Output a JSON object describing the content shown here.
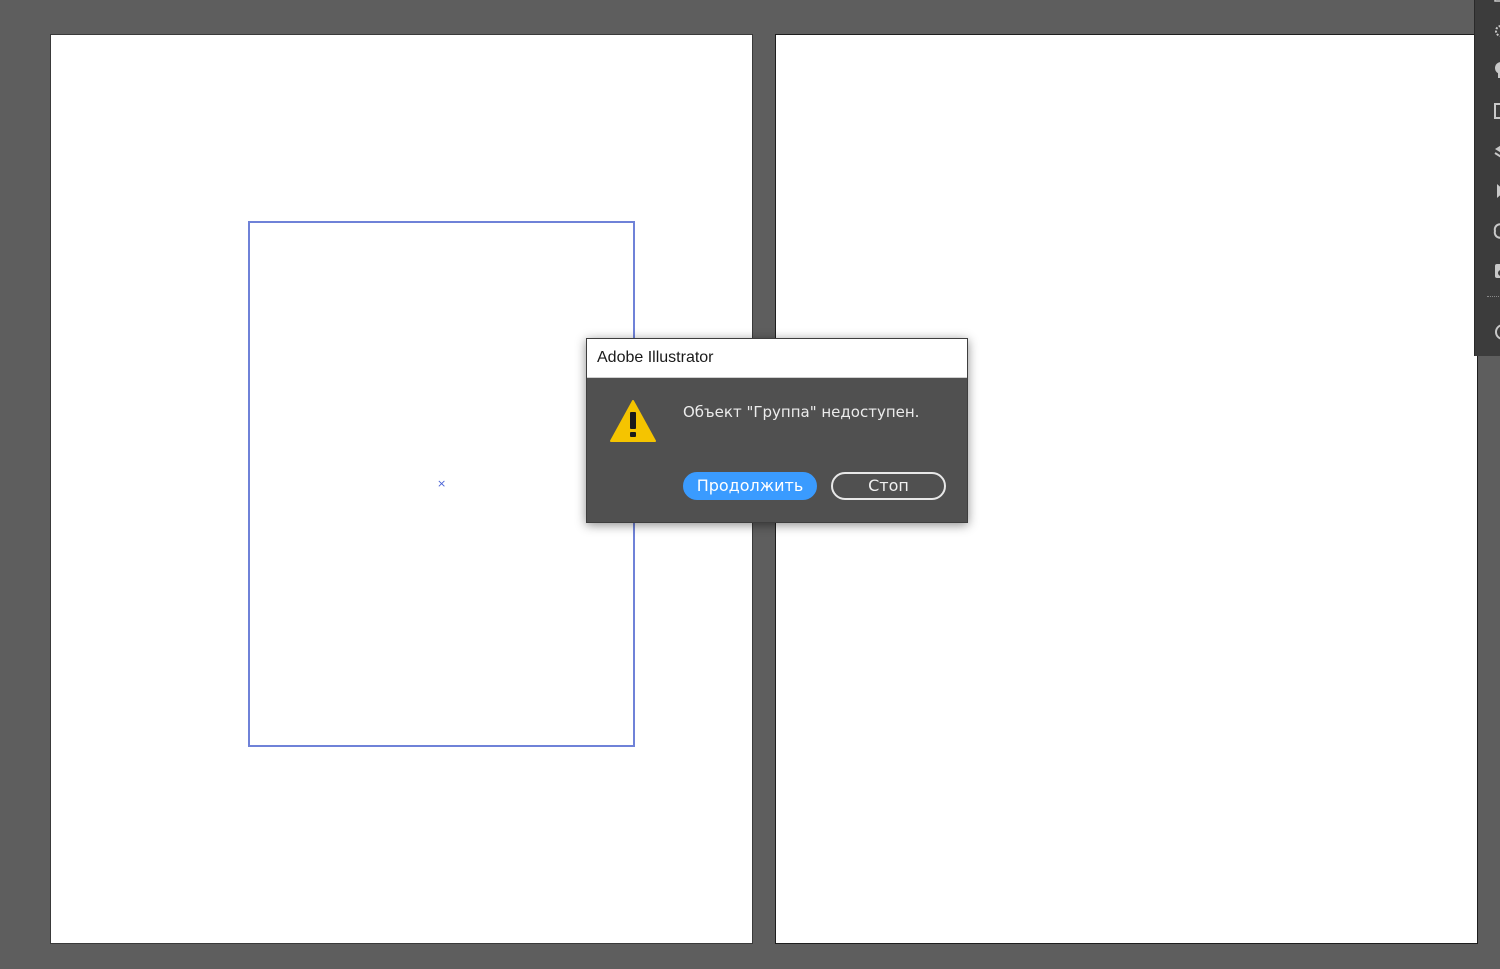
{
  "dialog": {
    "title": "Adobe Illustrator",
    "message": "Объект \"Группа\" недоступен.",
    "icon": "warning-icon",
    "buttons": {
      "continue_label": "Продолжить",
      "stop_label": "Стоп"
    }
  },
  "canvas": {
    "center_marker": "×"
  },
  "right_panel": {
    "tools": [
      "brightness-icon",
      "brush-icon",
      "rectangle-icon",
      "layers-icon",
      "play-icon",
      "link-icon",
      "image-icon",
      "appearance-icon"
    ]
  },
  "colors": {
    "canvas_background": "#5e5e5e",
    "selection": "#6f82d8",
    "primary_button": "#3a9bff",
    "warning": "#f5c400"
  }
}
